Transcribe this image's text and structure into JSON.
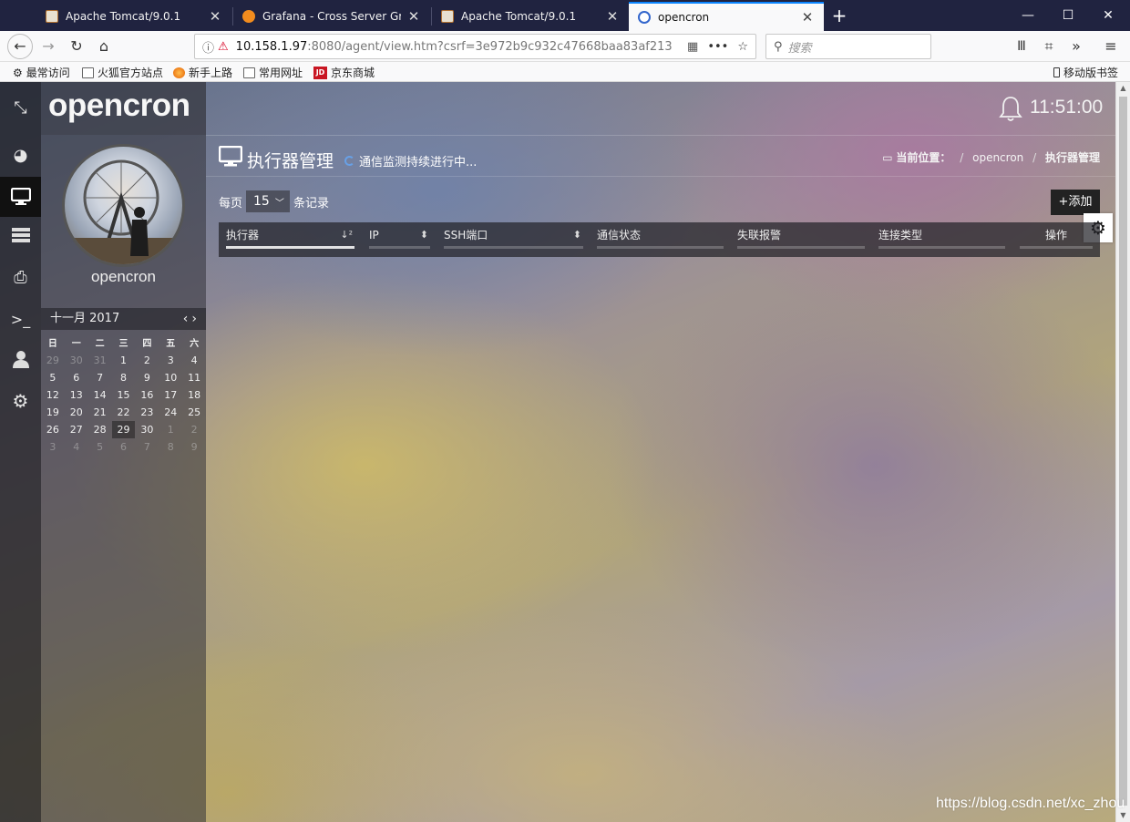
{
  "browser": {
    "tabs": [
      {
        "title": "Apache Tomcat/9.0.1"
      },
      {
        "title": "Grafana - Cross Server Graph"
      },
      {
        "title": "Apache Tomcat/9.0.1"
      },
      {
        "title": "opencron"
      }
    ],
    "active_tab_index": 3,
    "url_host": "10.158.1.97",
    "url_rest": ":8080/agent/view.htm?csrf=3e972b9c932c47668baa83af213",
    "search_placeholder": "搜索",
    "bookmarks": [
      "最常访问",
      "火狐官方站点",
      "新手上路",
      "常用网址",
      "京东商城"
    ],
    "mobile_bookmarks": "移动版书签",
    "colors": {
      "tabbar": "#202340",
      "accent": "#0a84ff"
    }
  },
  "app": {
    "logo": "opencron",
    "username": "opencron",
    "clock": "11:51:00",
    "sidebar_icons": [
      "collapse-icon",
      "dashboard-icon",
      "monitor-icon",
      "server-icon",
      "printer-icon",
      "terminal-icon",
      "user-icon",
      "settings-icon"
    ],
    "active_sidebar_index": 2
  },
  "calendar": {
    "month_title": "十一月 2017",
    "weekdays": [
      "日",
      "一",
      "二",
      "三",
      "四",
      "五",
      "六"
    ],
    "weeks": [
      [
        "29",
        "30",
        "31",
        "1",
        "2",
        "3",
        "4"
      ],
      [
        "5",
        "6",
        "7",
        "8",
        "9",
        "10",
        "11"
      ],
      [
        "12",
        "13",
        "14",
        "15",
        "16",
        "17",
        "18"
      ],
      [
        "19",
        "20",
        "21",
        "22",
        "23",
        "24",
        "25"
      ],
      [
        "26",
        "27",
        "28",
        "29",
        "30",
        "1",
        "2"
      ],
      [
        "3",
        "4",
        "5",
        "6",
        "7",
        "8",
        "9"
      ]
    ],
    "today": "29"
  },
  "page": {
    "title": "执行器管理",
    "monitor_status": "通信监测持续进行中...",
    "breadcrumb_label": "当前位置：",
    "breadcrumb": [
      "opencron",
      "执行器管理"
    ],
    "per_page_label": "每页",
    "per_page_value": "15",
    "records_label": "条记录",
    "add_button": "+添加"
  },
  "table": {
    "columns": [
      "执行器",
      "IP",
      "SSH端口",
      "通信状态",
      "失联报警",
      "连接类型",
      "操作"
    ],
    "sorted_column": 0
  },
  "watermark": "https://blog.csdn.net/xc_zhou"
}
